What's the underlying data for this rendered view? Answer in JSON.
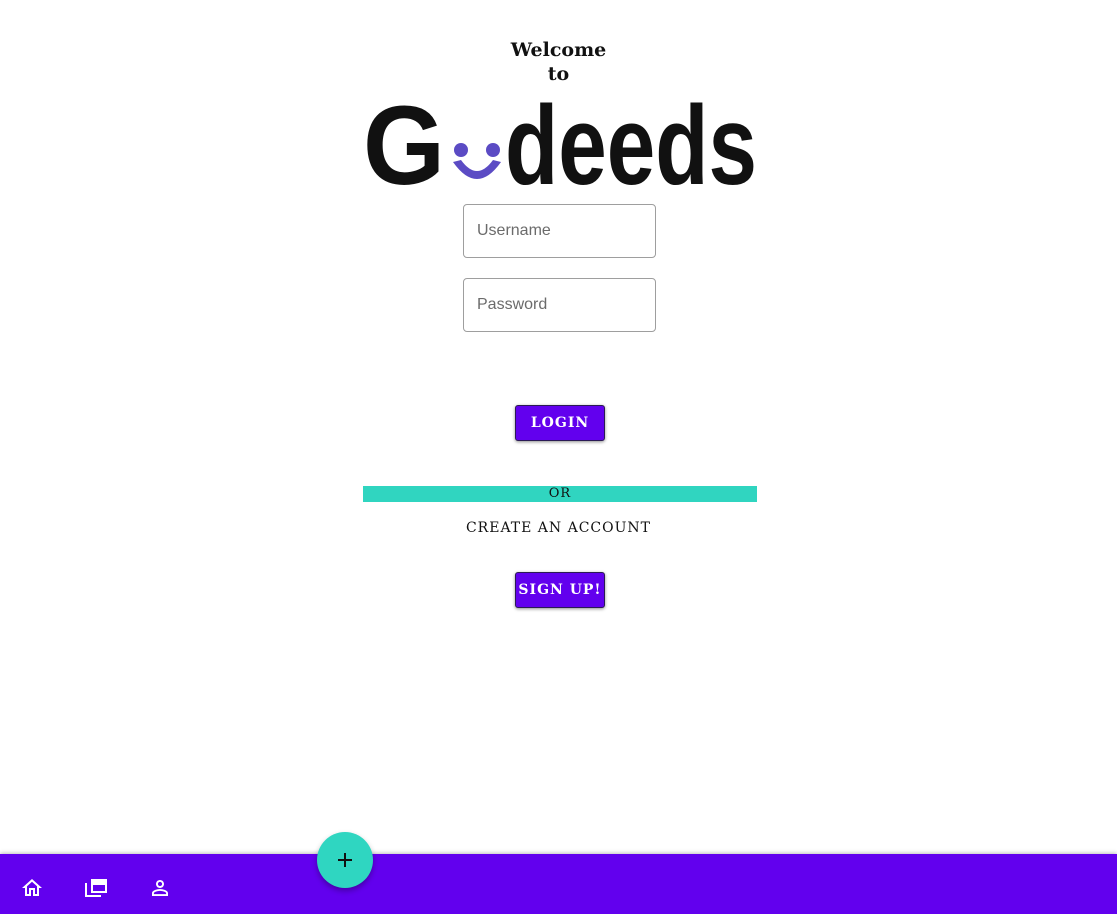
{
  "welcome": {
    "line1": "Welcome",
    "line2": "to"
  },
  "logo": {
    "text_start": "G",
    "text_end": "deeds",
    "smile_color": "#5b4bc4",
    "icon": "smiley-face-icon"
  },
  "form": {
    "username_placeholder": "Username",
    "password_placeholder": "Password",
    "login_label": "LOGIN"
  },
  "divider": {
    "or_label": "OR"
  },
  "signup": {
    "create_label": "CREATE AN ACCOUNT",
    "button_label": "SIGN UP!"
  },
  "bottom_nav": {
    "items": [
      {
        "icon": "home-icon"
      },
      {
        "icon": "gallery-icon"
      },
      {
        "icon": "person-icon"
      }
    ],
    "fab_icon": "plus-icon"
  },
  "colors": {
    "primary": "#6200ee",
    "accent": "#2fd6c1",
    "text": "#111111"
  }
}
